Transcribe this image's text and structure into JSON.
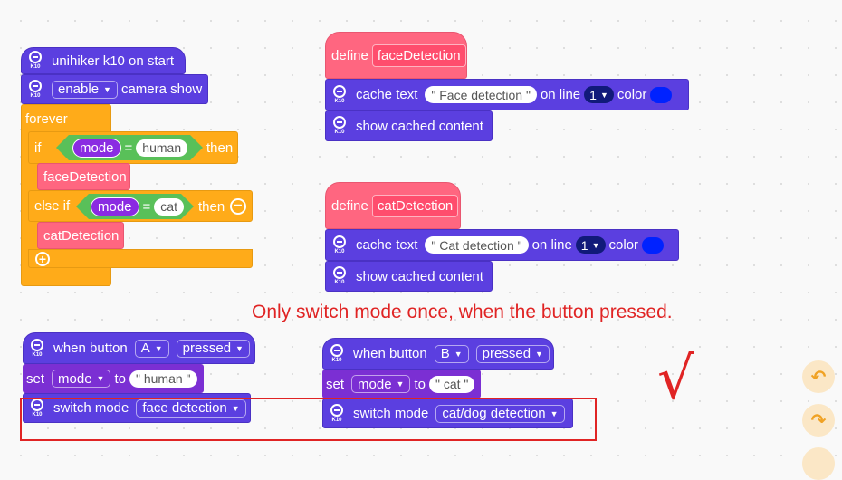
{
  "icon_caption": "K10",
  "stack1": {
    "hat": "unihiker k10 on start",
    "enable_dd": "enable",
    "camera_show": "camera show",
    "forever": "forever",
    "if_label": "if",
    "mode_var1": "mode",
    "eq1": "=",
    "human_val": "human",
    "then1": "then",
    "call_face": "faceDetection",
    "elseif_label": "else if",
    "mode_var2": "mode",
    "eq2": "=",
    "cat_val": "cat",
    "then2": "then",
    "call_cat": "catDetection"
  },
  "define_face": {
    "define_label": "define",
    "name": "faceDetection",
    "cache_text": "cache text",
    "text_val": "\" Face detection \"",
    "on_line": "on line",
    "line_num": "1",
    "color_label": "color",
    "show_cached": "show cached content"
  },
  "define_cat": {
    "define_label": "define",
    "name": "catDetection",
    "cache_text": "cache text",
    "text_val": "\" Cat detection \"",
    "on_line": "on line",
    "line_num": "1",
    "color_label": "color",
    "show_cached": "show cached content"
  },
  "annotation": "Only switch mode once, when the button pressed.",
  "checkmark": "√",
  "button_a": {
    "when_button": "when button",
    "button": "A",
    "event": "pressed",
    "set_label": "set",
    "var": "mode",
    "to_label": "to",
    "value": "\" human \"",
    "switch_mode": "switch mode",
    "mode_opt": "face detection"
  },
  "button_b": {
    "when_button": "when button",
    "button": "B",
    "event": "pressed",
    "set_label": "set",
    "var": "mode",
    "to_label": "to",
    "value": "\" cat \"",
    "switch_mode": "switch mode",
    "mode_opt": "cat/dog detection"
  },
  "colors": {
    "extension_block": "#5b3fe0",
    "control_block": "#ffab19",
    "operator_block": "#59c059",
    "custom_block": "#ff6680",
    "variable_block": "#8a2be2",
    "annotation_red": "#e02424",
    "swatch_blue": "#0022ff"
  },
  "icons": [
    "k10-board-icon",
    "undo-icon",
    "redo-icon",
    "plus-icon",
    "minus-icon"
  ]
}
